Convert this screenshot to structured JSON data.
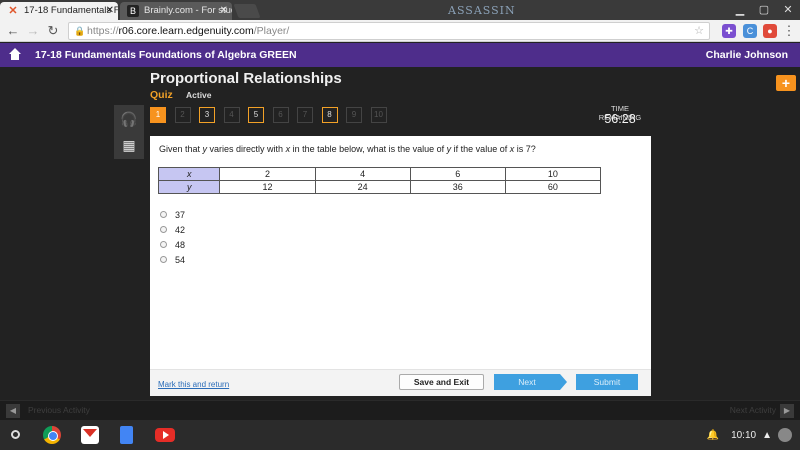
{
  "browser": {
    "tabs": [
      {
        "title": "17-18 Fundamentals Fo"
      },
      {
        "title": "Brainly.com - For studen"
      }
    ],
    "brand_text": "ASSASSIN",
    "url_scheme": "https://",
    "url_host": "r06.core.learn.edgenuity.com",
    "url_path": "/Player/",
    "extensions": [
      {
        "icon": "puzzle-icon",
        "color": "#7b4fd0"
      },
      {
        "icon": "c-icon",
        "color": "#4a90d9"
      },
      {
        "icon": "stop-icon",
        "color": "#e04a3a"
      }
    ]
  },
  "course": {
    "title": "17-18 Fundamentals Foundations of Algebra GREEN",
    "user": "Charlie Johnson",
    "brand_color": "#4e2d8b"
  },
  "lesson": {
    "title": "Proportional Relationships",
    "type": "Quiz",
    "status": "Active"
  },
  "question_nav": [
    {
      "n": "1",
      "state": "current"
    },
    {
      "n": "2",
      "state": "unanswered"
    },
    {
      "n": "3",
      "state": "answered"
    },
    {
      "n": "4",
      "state": "unanswered"
    },
    {
      "n": "5",
      "state": "answered"
    },
    {
      "n": "6",
      "state": "unanswered"
    },
    {
      "n": "7",
      "state": "unanswered"
    },
    {
      "n": "8",
      "state": "answered"
    },
    {
      "n": "9",
      "state": "unanswered"
    },
    {
      "n": "10",
      "state": "unanswered"
    }
  ],
  "timer": {
    "label": "TIME REMAINING",
    "value": "56:28"
  },
  "tools": [
    {
      "icon": "headphones-icon",
      "glyph": "🎧"
    },
    {
      "icon": "calculator-icon",
      "glyph": "▦"
    }
  ],
  "question": {
    "p1": "Given that ",
    "v1": "y",
    "p2": " varies directly with ",
    "v2": "x",
    "p3": " in the table below, what is the value of ",
    "v3": "y",
    "p4": " if the value of ",
    "v4": "x",
    "p5": " is 7?",
    "table": {
      "row_x_label": "x",
      "row_x": [
        "2",
        "4",
        "6",
        "10"
      ],
      "row_y_label": "y",
      "row_y": [
        "12",
        "24",
        "36",
        "60"
      ]
    },
    "choices": [
      "37",
      "42",
      "48",
      "54"
    ]
  },
  "footer": {
    "mark_link": "Mark this and return",
    "save_label": "Save and Exit",
    "next_label": "Next",
    "submit_label": "Submit"
  },
  "activity_bar": {
    "prev_label": "Previous Activity",
    "next_label": "Next Activity"
  },
  "shelf": {
    "apps": [
      "chrome-icon",
      "gmail-icon",
      "docs-icon",
      "youtube-icon"
    ],
    "time": "10:10"
  }
}
